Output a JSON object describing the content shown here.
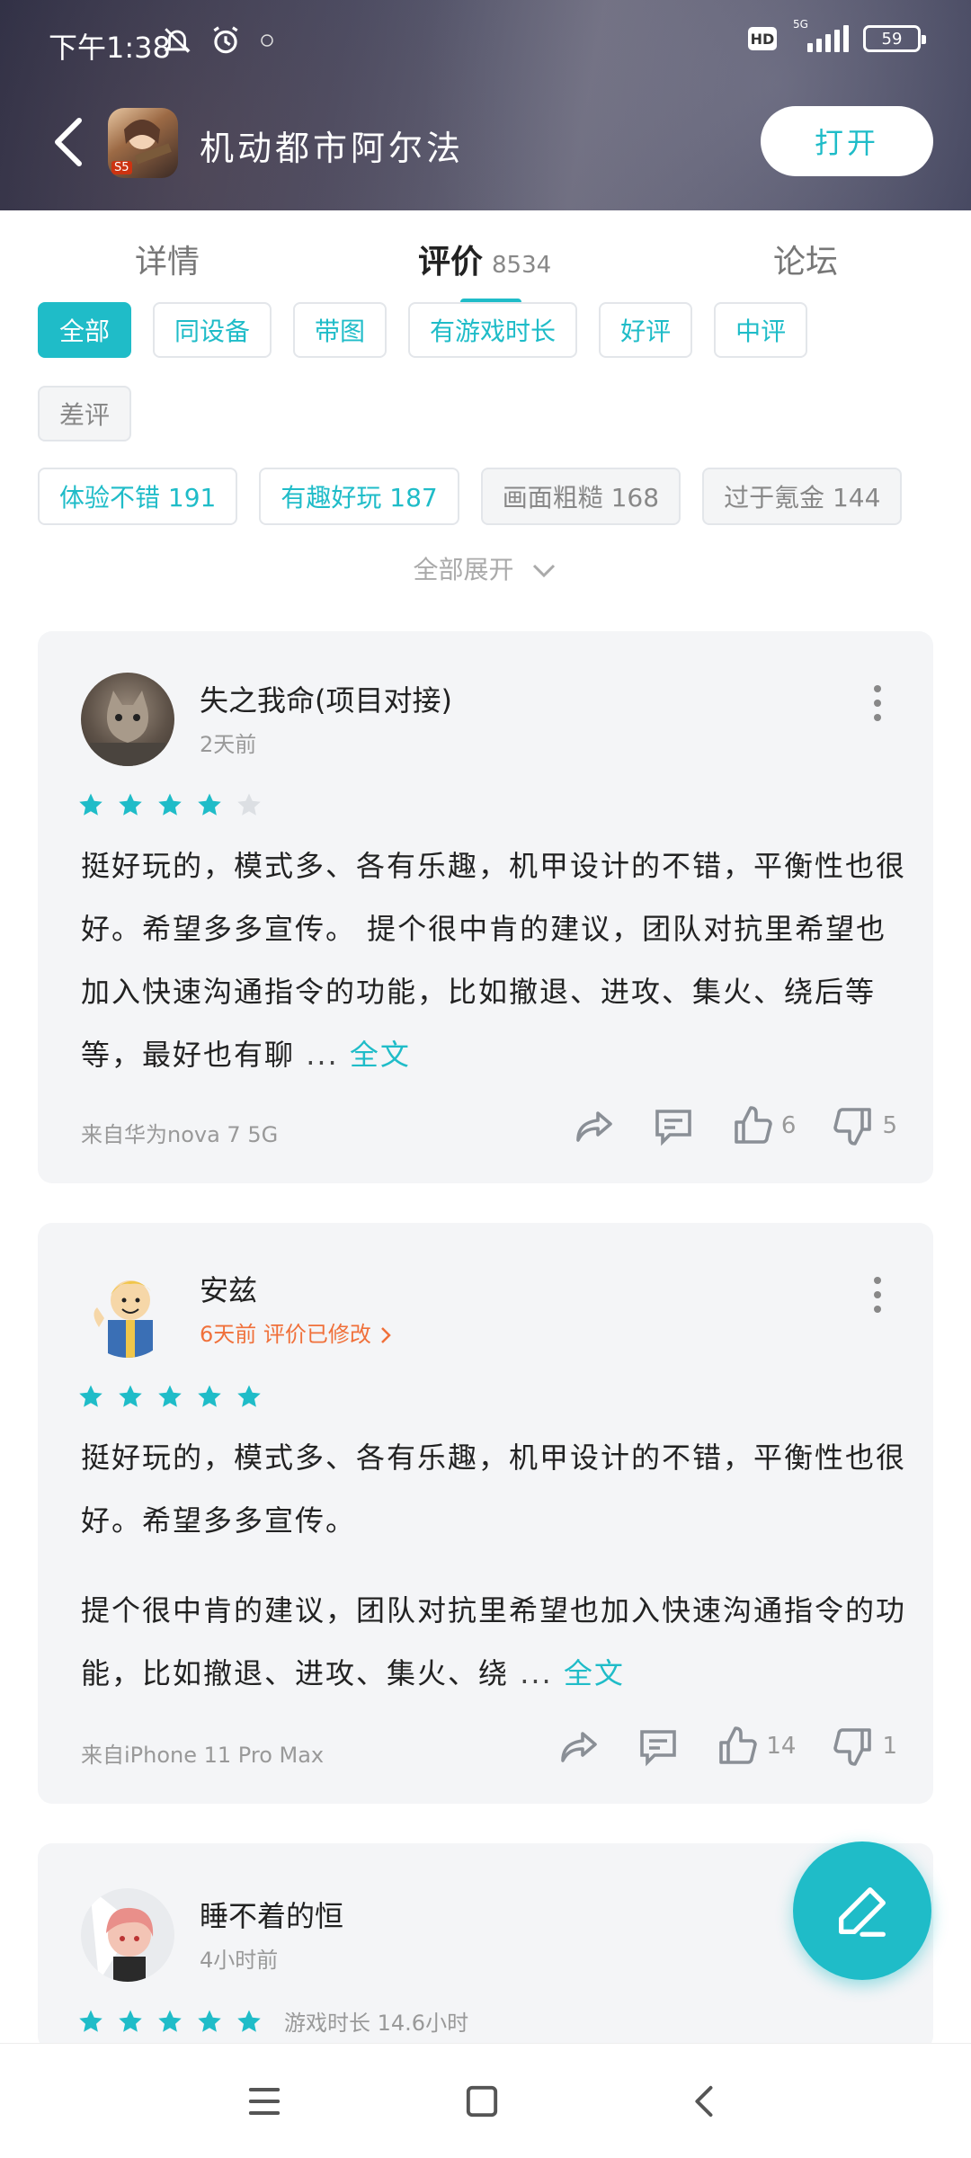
{
  "status": {
    "time": "下午1:38",
    "battery": "59",
    "network": "5G",
    "hd": "HD"
  },
  "app": {
    "title": "机动都市阿尔法",
    "open_button": "打开",
    "icon_badge": "S5"
  },
  "tabs": [
    {
      "label": "详情"
    },
    {
      "label": "评价",
      "count": "8534"
    },
    {
      "label": "论坛"
    }
  ],
  "filters": [
    {
      "label": "全部",
      "active": true
    },
    {
      "label": "同设备"
    },
    {
      "label": "带图"
    },
    {
      "label": "有游戏时长"
    },
    {
      "label": "好评"
    },
    {
      "label": "中评"
    },
    {
      "label": "差评"
    }
  ],
  "tags": [
    {
      "label": "体验不错 191"
    },
    {
      "label": "有趣好玩 187"
    },
    {
      "label": "画面粗糙 168"
    },
    {
      "label": "过于氪金 144"
    }
  ],
  "expand_label": "全部展开",
  "reviews": [
    {
      "user": "失之我命(项目对接)",
      "time": "2天前",
      "rating": 4,
      "text": "挺好玩的，模式多、各有乐趣，机甲设计的不错，平衡性也很好。希望多多宣传。 提个很中肯的建议，团队对抗里希望也加入快速沟通指令的功能，比如撤退、进攻、集火、绕后等等，最好也有聊",
      "ellipsis": "...",
      "full_link": "全文",
      "device": "来自华为nova 7 5G",
      "likes": "6",
      "dislikes": "5"
    },
    {
      "user": "安兹",
      "time": "6天前 评价已修改",
      "rating": 5,
      "text_p1": "挺好玩的，模式多、各有乐趣，机甲设计的不错，平衡性也很好。希望多多宣传。",
      "text_p2": "提个很中肯的建议，团队对抗里希望也加入快速沟通指令的功能，比如撤退、进攻、集火、绕",
      "ellipsis": "...",
      "full_link": "全文",
      "device": "来自iPhone 11 Pro Max",
      "likes": "14",
      "dislikes": "1"
    },
    {
      "user": "睡不着的恒",
      "time": "4小时前",
      "rating": 5,
      "playtime": "游戏时长 14.6小时"
    }
  ],
  "colors": {
    "accent": "#1fbcc8",
    "orange": "#f0703a",
    "card_bg": "#f4f5f7"
  }
}
